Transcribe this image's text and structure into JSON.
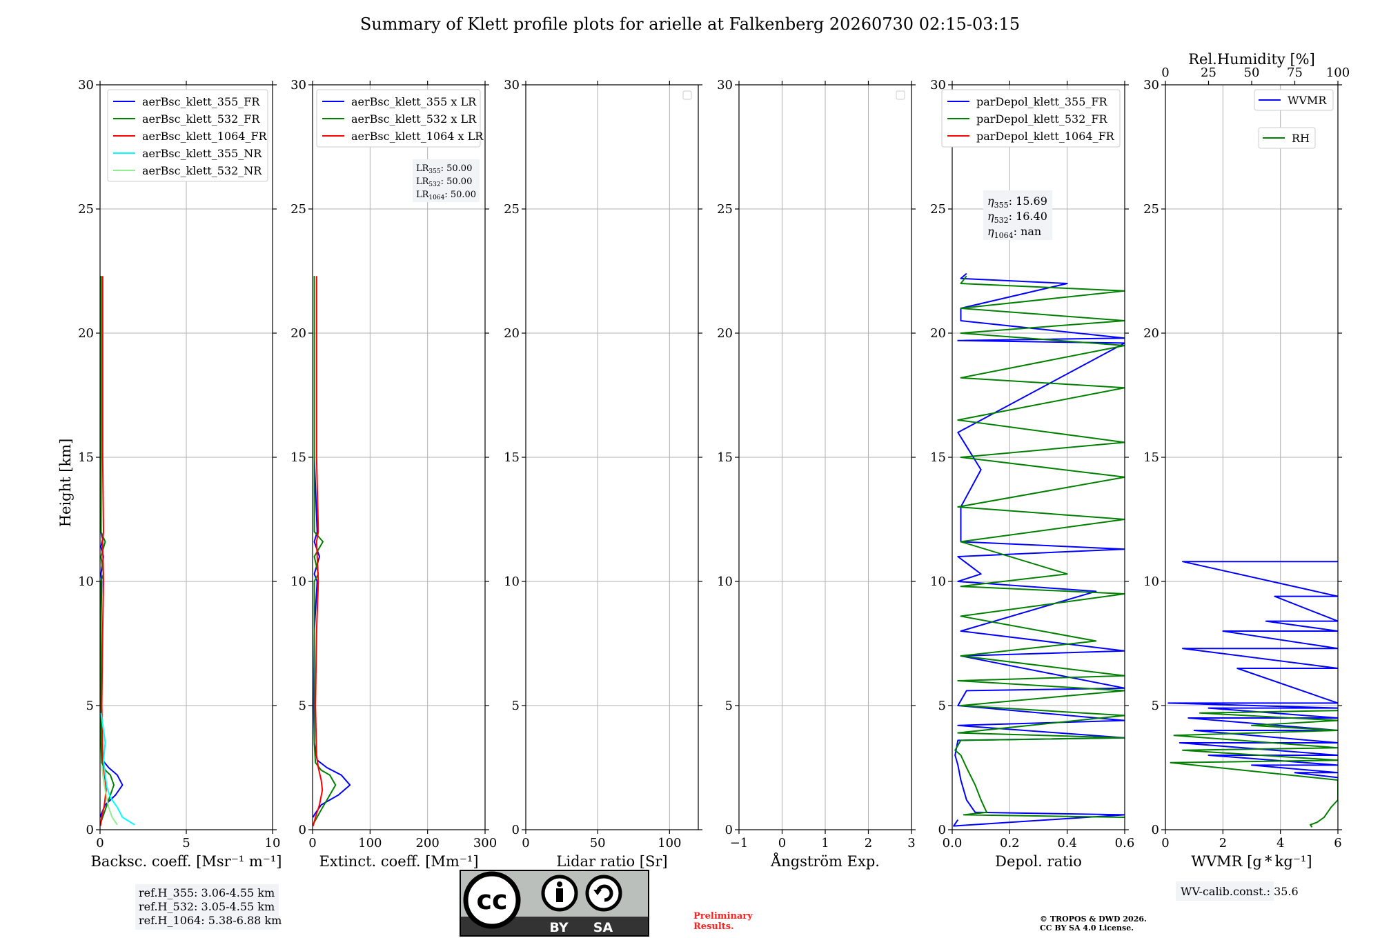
{
  "title": "Summary of Klett profile plots for arielle at Falkenberg 20260730 02:15-03:15",
  "ylabel": "Height [km]",
  "chart_data": [
    {
      "id": "backscatter",
      "type": "line",
      "xlabel": "Backsc. coeff. [Msr⁻¹ m⁻¹]",
      "xlim": [
        0,
        10
      ],
      "ylim": [
        0,
        30
      ],
      "xticks": [
        0,
        5,
        10
      ],
      "yticks": [
        0,
        5,
        10,
        15,
        20,
        25,
        30
      ],
      "grid": true,
      "legend_position": "upper-right",
      "series": [
        {
          "name": "aerBsc_klett_355_FR",
          "color": "#0000ff",
          "x": [
            0.02,
            0.05,
            0.3,
            0.9,
            1.3,
            1.0,
            0.5,
            0.15,
            0.05,
            0.03,
            0.04,
            0.1,
            0.05,
            0.2,
            0.05,
            0.15,
            0.05,
            0.05,
            0.06,
            0.05,
            0.05,
            0.06
          ],
          "y": [
            0.5,
            0.6,
            1.0,
            1.4,
            1.8,
            2.2,
            2.5,
            2.8,
            3.5,
            5,
            8,
            10,
            10.3,
            11,
            11.4,
            11.7,
            12,
            15,
            18,
            20,
            21.5,
            22.3
          ]
        },
        {
          "name": "aerBsc_klett_532_FR",
          "color": "#008000",
          "x": [
            0.02,
            0.05,
            0.3,
            0.6,
            0.8,
            0.6,
            0.3,
            0.1,
            0.05,
            0.05,
            0.2,
            0.05,
            0.3,
            0.05,
            0.05,
            0.06,
            0.06
          ],
          "y": [
            0.2,
            0.3,
            0.8,
            1.4,
            1.8,
            2.2,
            2.4,
            2.7,
            3.5,
            10,
            10.3,
            11,
            11.6,
            12,
            15,
            20,
            22.3
          ]
        },
        {
          "name": "aerBsc_klett_1064_FR",
          "color": "#ff0000",
          "x": [
            0.02,
            0.1,
            0.25,
            0.35,
            0.3,
            0.2,
            0.15,
            0.1,
            0.15,
            0.2,
            0.15,
            0.2,
            0.15,
            0.15,
            0.15
          ],
          "y": [
            0.15,
            0.5,
            1.0,
            1.6,
            2.0,
            2.5,
            3.0,
            5,
            8,
            10,
            11.6,
            12,
            15,
            20,
            22.3
          ]
        },
        {
          "name": "aerBsc_klett_355_NR",
          "color": "#00ffff",
          "x": [
            2.0,
            1.3,
            1.0,
            0.6,
            0.4,
            0.3,
            0.2,
            0.3,
            0.1,
            0.05
          ],
          "y": [
            0.2,
            0.5,
            0.9,
            1.3,
            1.7,
            2.2,
            2.8,
            3.5,
            4.5,
            4.7
          ]
        },
        {
          "name": "aerBsc_klett_532_NR",
          "color": "#90ee90",
          "x": [
            1.0,
            0.7,
            0.5,
            0.35,
            0.2,
            0.1
          ],
          "y": [
            0.2,
            0.5,
            0.9,
            1.4,
            2.0,
            2.6
          ]
        }
      ],
      "annotation": [
        "ref.H_355: 3.06-4.55 km",
        "ref.H_532: 3.05-4.55 km",
        "ref.H_1064: 5.38-6.88 km"
      ]
    },
    {
      "id": "extinction",
      "type": "line",
      "xlabel": "Extinct. coeff. [Mm⁻¹]",
      "xlim": [
        0,
        300
      ],
      "ylim": [
        0,
        30
      ],
      "xticks": [
        0,
        100,
        200,
        300
      ],
      "yticks": [
        0,
        5,
        10,
        15,
        20,
        25,
        30
      ],
      "grid": true,
      "legend_position": "upper-right",
      "series": [
        {
          "name": "aerBsc_klett_355 x LR",
          "color": "#0000ff",
          "x": [
            1,
            3,
            15,
            45,
            65,
            50,
            25,
            8,
            3,
            2,
            3,
            8,
            3,
            12,
            3,
            8,
            3,
            3,
            3,
            3,
            3
          ],
          "y": [
            0.5,
            0.6,
            1.0,
            1.4,
            1.8,
            2.2,
            2.5,
            2.8,
            3.5,
            5,
            8,
            10,
            10.3,
            11,
            11.6,
            12,
            15,
            18,
            20,
            21.5,
            22.3
          ]
        },
        {
          "name": "aerBsc_klett_532 x LR",
          "color": "#008000",
          "x": [
            1,
            3,
            15,
            30,
            40,
            30,
            15,
            5,
            3,
            3,
            10,
            3,
            18,
            3,
            3,
            3,
            3
          ],
          "y": [
            0.2,
            0.3,
            0.8,
            1.4,
            1.8,
            2.2,
            2.4,
            2.7,
            3.5,
            10,
            10.3,
            11,
            11.6,
            12,
            15,
            20,
            22.3
          ]
        },
        {
          "name": "aerBsc_klett_1064 x LR",
          "color": "#ff0000",
          "x": [
            1,
            5,
            12,
            17,
            15,
            10,
            7,
            5,
            7,
            10,
            7,
            10,
            7,
            7,
            7
          ],
          "y": [
            0.15,
            0.5,
            1.0,
            1.6,
            2.0,
            2.5,
            3.0,
            5,
            8,
            10,
            11.6,
            12,
            15,
            20,
            22.3
          ]
        }
      ],
      "annotation": [
        {
          "sym": "LR",
          "sub": "355",
          "val": ": 50.00"
        },
        {
          "sym": "LR",
          "sub": "532",
          "val": ": 50.00"
        },
        {
          "sym": "LR",
          "sub": "1064",
          "val": ": 50.00"
        }
      ]
    },
    {
      "id": "lidar-ratio",
      "type": "line",
      "xlabel": "Lidar ratio [Sr]",
      "xlim": [
        0,
        120
      ],
      "ylim": [
        0,
        30
      ],
      "xticks": [
        0,
        50,
        100
      ],
      "yticks": [
        0,
        5,
        10,
        15,
        20,
        25,
        30
      ],
      "grid": true,
      "legend_position": "upper-right",
      "series": []
    },
    {
      "id": "angstrom",
      "type": "line",
      "xlabel": "Ångström Exp.",
      "xlim": [
        -1,
        3
      ],
      "ylim": [
        0,
        30
      ],
      "xticks": [
        -1,
        0,
        1,
        2,
        3
      ],
      "yticks": [
        0,
        5,
        10,
        15,
        20,
        25,
        30
      ],
      "grid": true,
      "legend_position": "upper-right",
      "series": []
    },
    {
      "id": "depol",
      "type": "line",
      "xlabel": "Depol. ratio",
      "xlim": [
        0,
        0.6
      ],
      "ylim": [
        0,
        30
      ],
      "xticks": [
        0.0,
        0.2,
        0.4,
        0.6
      ],
      "yticks": [
        0,
        5,
        10,
        15,
        20,
        25,
        30
      ],
      "grid": true,
      "legend_position": "upper-right",
      "series": [
        {
          "name": "parDepol_klett_355_FR",
          "color": "#0000ff",
          "x": [
            0.02,
            0.005,
            0.6,
            0.08,
            0.05,
            0.03,
            0.02,
            0.01,
            0.02,
            0.6,
            0.02,
            0.6,
            0.02,
            0.05,
            0.6,
            0.03,
            0.6,
            0.03,
            0.5,
            0.02,
            0.1,
            0.02,
            0.6,
            0.03,
            0.03,
            0.1,
            0.02,
            0.6,
            0.02,
            0.6,
            0.03,
            0.03,
            0.4,
            0.03,
            0.05
          ],
          "y": [
            0.4,
            0.15,
            0.6,
            0.7,
            1.2,
            2,
            2.6,
            3.0,
            3.6,
            3.7,
            4.2,
            4.4,
            5.0,
            5.6,
            5.7,
            7.0,
            7.2,
            8,
            9.6,
            10.0,
            10.3,
            11,
            11.3,
            11.6,
            13,
            14.5,
            16,
            19.6,
            19.7,
            19.8,
            20.5,
            21,
            22,
            22.2,
            22.4
          ]
        },
        {
          "name": "parDepol_klett_532_FR",
          "color": "#008000",
          "x": [
            0.6,
            0.04,
            0.12,
            0.1,
            0.08,
            0.05,
            0.03,
            0.01,
            0.03,
            0.6,
            0.02,
            0.6,
            0.03,
            0.6,
            0.02,
            0.6,
            0.03,
            0.5,
            0.03,
            0.6,
            0.03,
            0.4,
            0.03,
            0.6,
            0.02,
            0.6,
            0.03,
            0.6,
            0.02,
            0.6,
            0.03,
            0.6,
            0.03,
            0.6,
            0.03,
            0.6,
            0.03,
            0.05
          ],
          "y": [
            0.5,
            0.6,
            0.7,
            1.2,
            1.8,
            2.5,
            3.0,
            3.2,
            3.6,
            3.7,
            3.9,
            4.6,
            5.0,
            5.6,
            6.0,
            6.2,
            7.0,
            7.6,
            8.6,
            9.5,
            9.8,
            10.3,
            11.6,
            12.5,
            13,
            14.2,
            15,
            15.6,
            16.5,
            17.8,
            18.2,
            19.5,
            20.0,
            20.5,
            21.0,
            21.7,
            22.0,
            22.3
          ]
        },
        {
          "name": "parDepol_klett_1064_FR",
          "color": "#ff0000",
          "x": [],
          "y": []
        }
      ],
      "annotation": [
        {
          "sym": "η",
          "sub": "355",
          "val": ": 15.69"
        },
        {
          "sym": "η",
          "sub": "532",
          "val": ": 16.40"
        },
        {
          "sym": "η",
          "sub": "1064",
          "val": ": nan"
        }
      ]
    },
    {
      "id": "wvmr",
      "type": "line",
      "xlabel": "WVMR [g * kg⁻¹]",
      "x2label": "Rel.Humidity [%]",
      "xlim": [
        0,
        6
      ],
      "x2lim": [
        0,
        100
      ],
      "ylim": [
        0,
        30
      ],
      "xticks": [
        0,
        2,
        4,
        6
      ],
      "x2ticks": [
        0,
        25,
        50,
        75,
        100
      ],
      "yticks": [
        0,
        5,
        10,
        15,
        20,
        25,
        30
      ],
      "grid": true,
      "legend_position": "upper-right",
      "series": [
        {
          "name": "WVMR",
          "color": "#0000ff",
          "x": [
            6,
            0.6,
            6,
            3.8,
            6,
            3.5,
            6,
            2.0,
            6,
            0.6,
            6,
            2.5,
            6,
            0.1,
            6,
            1.5,
            6,
            0.8,
            6,
            1.0,
            6,
            0.5,
            6,
            1.5,
            6,
            3.0,
            6,
            4.5,
            6
          ],
          "y": [
            10.8,
            10.8,
            9.4,
            9.4,
            8.4,
            8.4,
            8.0,
            8.0,
            7.3,
            7.3,
            6.5,
            6.5,
            5.1,
            5.1,
            4.9,
            4.9,
            4.5,
            4.5,
            4.0,
            4.0,
            3.5,
            3.5,
            3.0,
            3.0,
            2.6,
            2.6,
            2.3,
            2.3,
            2.1
          ]
        },
        {
          "name": "RH",
          "color": "#008000",
          "x": [
            85,
            84,
            88,
            92,
            96,
            100,
            100,
            3,
            100,
            10,
            100,
            5,
            100,
            50,
            100,
            20,
            100
          ],
          "y": [
            0.1,
            0.2,
            0.3,
            0.5,
            0.9,
            1.2,
            2.0,
            2.7,
            2.8,
            3.2,
            3.3,
            3.8,
            4.0,
            4.2,
            4.4,
            4.7,
            4.8
          ]
        }
      ],
      "annotation": [
        "WV-calib.const.: 35.6"
      ]
    }
  ],
  "license": {
    "badge_cc": "cc",
    "badge_by": "BY",
    "badge_sa": "SA",
    "preliminary": [
      "Preliminary",
      "Results."
    ],
    "copyright": [
      "© TROPOS & DWD 2026.",
      "CC BY SA 4.0 License."
    ]
  }
}
